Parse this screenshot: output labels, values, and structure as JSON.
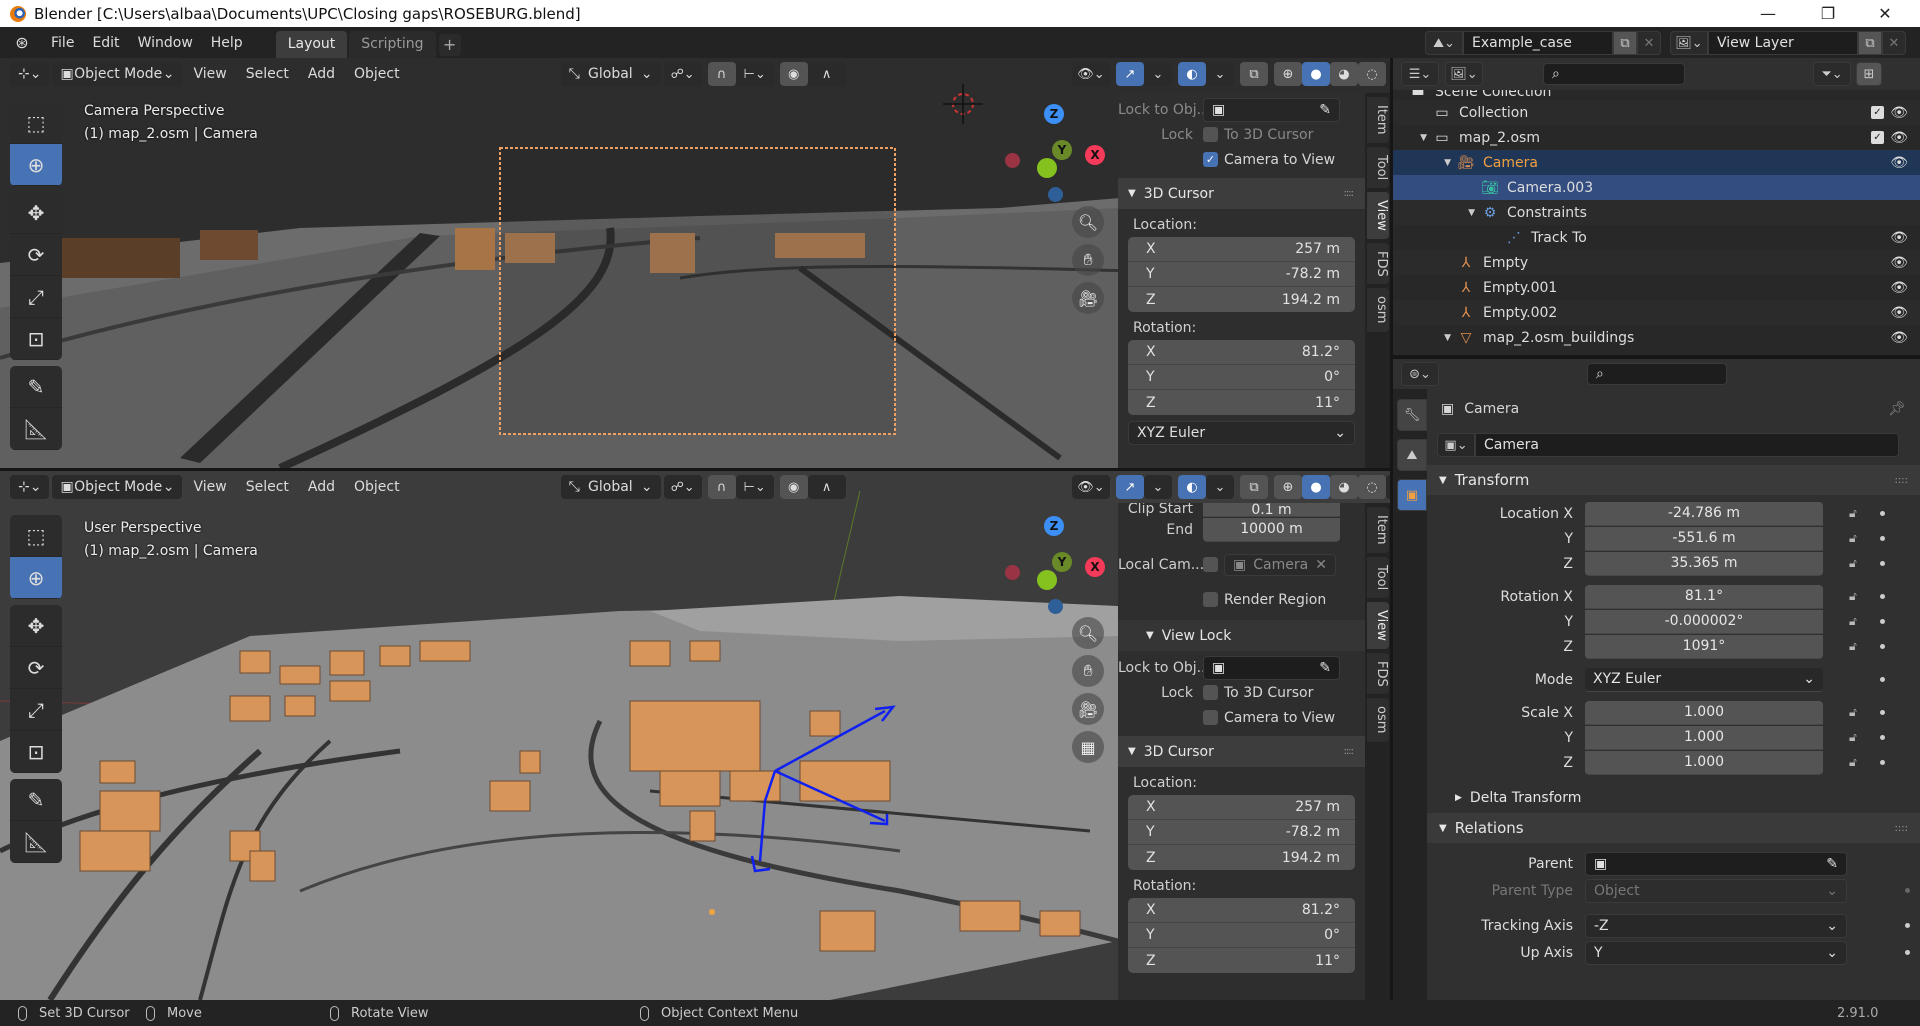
{
  "window": {
    "title": "Blender [C:\\Users\\albaa\\Documents\\UPC\\Closing gaps\\ROSEBURG.blend]",
    "controls": {
      "minimize": "—",
      "maximize": "❐",
      "close": "✕"
    }
  },
  "menubar": {
    "menus": [
      "File",
      "Edit",
      "Window",
      "Help"
    ],
    "workspaces": [
      {
        "label": "Layout",
        "active": true
      },
      {
        "label": "Scripting",
        "active": false
      }
    ],
    "add_workspace": "+",
    "scene": "Example_case",
    "view_layer": "View Layer"
  },
  "viewport_header": {
    "mode": "Object Mode",
    "menus": [
      "View",
      "Select",
      "Add",
      "Object"
    ],
    "orientation": "Global"
  },
  "top_viewport": {
    "view_name": "Camera Perspective",
    "object_info": "(1) map_2.osm | Camera"
  },
  "bottom_viewport": {
    "view_name": "User Perspective",
    "object_info": "(1) map_2.osm | Camera"
  },
  "gizmo": {
    "x": "X",
    "y": "Y",
    "z": "Z",
    "x_color": "#f53a5a",
    "y_color": "#85c220",
    "z_color": "#3b8ff5"
  },
  "toolbar": [
    "select-box",
    "cursor",
    "move",
    "rotate",
    "scale",
    "transform",
    "annotate",
    "measure"
  ],
  "sidebar_tabs": [
    {
      "label": "Item",
      "active": false
    },
    {
      "label": "Tool",
      "active": false
    },
    {
      "label": "View",
      "active": true
    },
    {
      "label": "FDS",
      "active": false
    },
    {
      "label": "osm",
      "active": false
    }
  ],
  "top_npanel": {
    "lock_to_object_label": "Lock to Obj...",
    "lock_label": "Lock",
    "to_3d_cursor": {
      "label": "To 3D Cursor",
      "checked": false
    },
    "camera_to_view": {
      "label": "Camera to View",
      "checked": true
    },
    "cursor_section": "3D Cursor",
    "location_label": "Location:",
    "location": [
      {
        "axis": "X",
        "value": "257 m"
      },
      {
        "axis": "Y",
        "value": "-78.2 m"
      },
      {
        "axis": "Z",
        "value": "194.2 m"
      }
    ],
    "rotation_label": "Rotation:",
    "rotation": [
      {
        "axis": "X",
        "value": "81.2°"
      },
      {
        "axis": "Y",
        "value": "0°"
      },
      {
        "axis": "Z",
        "value": "11°"
      }
    ],
    "rotation_mode": "XYZ Euler"
  },
  "bottom_npanel": {
    "clip_start_label": "Clip Start",
    "clip_start": "0.1 m",
    "end_label": "End",
    "end": "10000 m",
    "local_camera_label": "Local Cam...",
    "local_camera_value": "Camera",
    "local_camera_checked": false,
    "render_region": {
      "label": "Render Region",
      "checked": false
    },
    "view_lock_section": "View Lock",
    "lock_to_object_label": "Lock to Obj...",
    "lock_label": "Lock",
    "to_3d_cursor": {
      "label": "To 3D Cursor",
      "checked": false
    },
    "camera_to_view": {
      "label": "Camera to View",
      "checked": false
    },
    "cursor_section": "3D Cursor",
    "location_label": "Location:",
    "location": [
      {
        "axis": "X",
        "value": "257 m"
      },
      {
        "axis": "Y",
        "value": "-78.2 m"
      },
      {
        "axis": "Z",
        "value": "194.2 m"
      }
    ],
    "rotation_label": "Rotation:",
    "rotation": [
      {
        "axis": "X",
        "value": "81.2°"
      },
      {
        "axis": "Y",
        "value": "0°"
      },
      {
        "axis": "Z",
        "value": "11°"
      }
    ]
  },
  "outliner": {
    "search_placeholder": "",
    "items": [
      {
        "label": "Scene Collection",
        "depth": 0,
        "icon": "scene-collection",
        "state": ""
      },
      {
        "label": "Collection",
        "depth": 1,
        "icon": "collection",
        "checkbox": true,
        "eye": true,
        "state": ""
      },
      {
        "label": "map_2.osm",
        "depth": 1,
        "icon": "collection",
        "expand": true,
        "checkbox": true,
        "eye": true,
        "state": ""
      },
      {
        "label": "Camera",
        "depth": 2,
        "icon": "camera-object",
        "expand": true,
        "eye": true,
        "state": "active"
      },
      {
        "label": "Camera.003",
        "depth": 3,
        "icon": "camera-data",
        "state": "selected"
      },
      {
        "label": "Constraints",
        "depth": 3,
        "icon": "constraint",
        "expand": true,
        "state": ""
      },
      {
        "label": "Track To",
        "depth": 4,
        "icon": "track-to",
        "eye": true,
        "state": ""
      },
      {
        "label": "Empty",
        "depth": 2,
        "icon": "empty",
        "eye": true,
        "state": ""
      },
      {
        "label": "Empty.001",
        "depth": 2,
        "icon": "empty",
        "eye": true,
        "state": ""
      },
      {
        "label": "Empty.002",
        "depth": 2,
        "icon": "empty",
        "eye": true,
        "state": ""
      },
      {
        "label": "map_2.osm_buildings",
        "depth": 2,
        "icon": "mesh",
        "expand": true,
        "eye": true,
        "state": ""
      }
    ]
  },
  "properties": {
    "object_name_header": "Camera",
    "object_name_field": "Camera",
    "transform_section": "Transform",
    "location": [
      {
        "label": "Location X",
        "value": "-24.786 m"
      },
      {
        "label": "Y",
        "value": "-551.6 m"
      },
      {
        "label": "Z",
        "value": "35.365 m"
      }
    ],
    "rotation": [
      {
        "label": "Rotation X",
        "value": "81.1°"
      },
      {
        "label": "Y",
        "value": "-0.000002°"
      },
      {
        "label": "Z",
        "value": "1091°"
      }
    ],
    "mode_label": "Mode",
    "mode_value": "XYZ Euler",
    "scale": [
      {
        "label": "Scale X",
        "value": "1.000"
      },
      {
        "label": "Y",
        "value": "1.000"
      },
      {
        "label": "Z",
        "value": "1.000"
      }
    ],
    "delta_transform_section": "Delta Transform",
    "relations_section": "Relations",
    "parent_label": "Parent",
    "parent_value": "",
    "parent_type_label": "Parent Type",
    "parent_type_value": "Object",
    "tracking_axis_label": "Tracking Axis",
    "tracking_axis_value": "-Z",
    "up_axis_label": "Up Axis",
    "up_axis_value": "Y"
  },
  "statusbar": {
    "items": [
      "Set 3D Cursor",
      "Move",
      "Rotate View",
      "Object Context Menu"
    ],
    "version": "2.91.0"
  },
  "colors": {
    "accent": "#4772b3",
    "selected_row": "#334d80",
    "active_object": "#f0a040",
    "building": "#d8955a"
  }
}
